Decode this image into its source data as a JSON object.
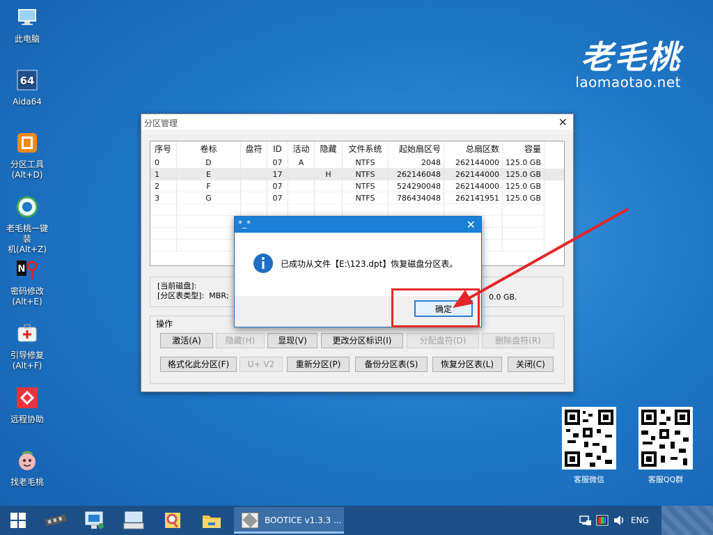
{
  "desktop": {
    "icons": [
      {
        "label": "此电脑",
        "icon": "computer-icon"
      },
      {
        "label": "Aida64",
        "icon": "aida64-icon"
      },
      {
        "label": "分区工具\n(Alt+D)",
        "icon": "partition-tool-icon"
      },
      {
        "label": "老毛桃一键装\n机(Alt+Z)",
        "icon": "one-click-install-icon"
      },
      {
        "label": "密码修改\n(Alt+E)",
        "icon": "password-reset-icon"
      },
      {
        "label": "引导修复\n(Alt+F)",
        "icon": "boot-repair-icon"
      },
      {
        "label": "远程协助",
        "icon": "remote-assist-icon"
      },
      {
        "label": "找老毛桃",
        "icon": "find-laomaotao-icon"
      }
    ],
    "brand": {
      "logo": "老毛桃",
      "url": "laomaotao.net"
    },
    "qr_codes": [
      {
        "label": "客服微信"
      },
      {
        "label": "客服QQ群"
      }
    ]
  },
  "partition_window": {
    "title": "分区管理",
    "columns": [
      "序号",
      "卷标",
      "盘符",
      "ID",
      "活动",
      "隐藏",
      "文件系统",
      "起始扇区号",
      "总扇区数",
      "容量"
    ],
    "rows": [
      [
        "0",
        "D",
        "",
        "07",
        "A",
        "",
        "NTFS",
        "2048",
        "262144000",
        "125.0 GB"
      ],
      [
        "1",
        "E",
        "",
        "17",
        "",
        "H",
        "NTFS",
        "262146048",
        "262144000",
        "125.0 GB"
      ],
      [
        "2",
        "F",
        "",
        "07",
        "",
        "",
        "NTFS",
        "524290048",
        "262144000",
        "125.0 GB"
      ],
      [
        "3",
        "G",
        "",
        "07",
        "",
        "",
        "NTFS",
        "786434048",
        "262141951",
        "125.0 GB"
      ]
    ],
    "info": {
      "current_disk_label": "[当前磁盘]:",
      "table_type_label": "[分区表类型]:",
      "table_type_value": "MBR;",
      "capacity_fragment": "0.0 GB."
    },
    "operations": {
      "label": "操作",
      "activate": "激活(A)",
      "hide": "隐藏(H)",
      "show": "显现(V)",
      "change_id": "更改分区标识(I)",
      "assign_letter": "分配盘符(D)",
      "remove_letter": "删除盘符(R)",
      "format": "格式化此分区(F)",
      "u_v2": "U+ V2",
      "repartition": "重新分区(P)",
      "backup": "备份分区表(S)",
      "restore": "恢复分区表(L)",
      "close": "关闭(C)"
    }
  },
  "message_dialog": {
    "title": "*_*",
    "message": "已成功从文件【E:\\123.dpt】恢复磁盘分区表。",
    "ok": "确定"
  },
  "taskbar": {
    "active_app": "BOOTICE v1.3.3 ...",
    "language": "ENG"
  },
  "colors": {
    "desktop": "#1f78c8",
    "taskbar": "#1c4f86",
    "dialog_title": "#1b7fd6",
    "highlight_box": "#e3262a",
    "arrow": "#e3262a"
  }
}
